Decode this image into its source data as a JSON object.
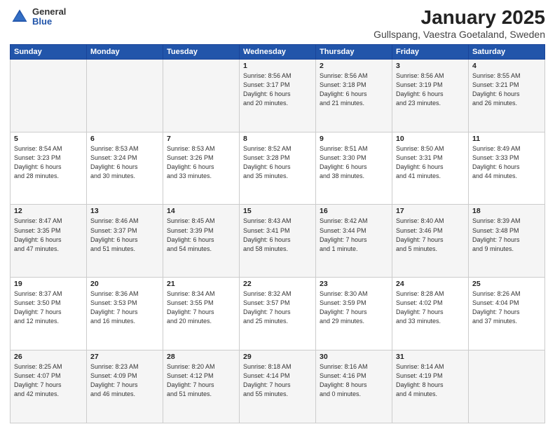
{
  "header": {
    "logo_general": "General",
    "logo_blue": "Blue",
    "title": "January 2025",
    "subtitle": "Gullspang, Vaestra Goetaland, Sweden"
  },
  "days_of_week": [
    "Sunday",
    "Monday",
    "Tuesday",
    "Wednesday",
    "Thursday",
    "Friday",
    "Saturday"
  ],
  "weeks": [
    [
      {
        "day": "",
        "info": ""
      },
      {
        "day": "",
        "info": ""
      },
      {
        "day": "",
        "info": ""
      },
      {
        "day": "1",
        "info": "Sunrise: 8:56 AM\nSunset: 3:17 PM\nDaylight: 6 hours\nand 20 minutes."
      },
      {
        "day": "2",
        "info": "Sunrise: 8:56 AM\nSunset: 3:18 PM\nDaylight: 6 hours\nand 21 minutes."
      },
      {
        "day": "3",
        "info": "Sunrise: 8:56 AM\nSunset: 3:19 PM\nDaylight: 6 hours\nand 23 minutes."
      },
      {
        "day": "4",
        "info": "Sunrise: 8:55 AM\nSunset: 3:21 PM\nDaylight: 6 hours\nand 26 minutes."
      }
    ],
    [
      {
        "day": "5",
        "info": "Sunrise: 8:54 AM\nSunset: 3:23 PM\nDaylight: 6 hours\nand 28 minutes."
      },
      {
        "day": "6",
        "info": "Sunrise: 8:53 AM\nSunset: 3:24 PM\nDaylight: 6 hours\nand 30 minutes."
      },
      {
        "day": "7",
        "info": "Sunrise: 8:53 AM\nSunset: 3:26 PM\nDaylight: 6 hours\nand 33 minutes."
      },
      {
        "day": "8",
        "info": "Sunrise: 8:52 AM\nSunset: 3:28 PM\nDaylight: 6 hours\nand 35 minutes."
      },
      {
        "day": "9",
        "info": "Sunrise: 8:51 AM\nSunset: 3:30 PM\nDaylight: 6 hours\nand 38 minutes."
      },
      {
        "day": "10",
        "info": "Sunrise: 8:50 AM\nSunset: 3:31 PM\nDaylight: 6 hours\nand 41 minutes."
      },
      {
        "day": "11",
        "info": "Sunrise: 8:49 AM\nSunset: 3:33 PM\nDaylight: 6 hours\nand 44 minutes."
      }
    ],
    [
      {
        "day": "12",
        "info": "Sunrise: 8:47 AM\nSunset: 3:35 PM\nDaylight: 6 hours\nand 47 minutes."
      },
      {
        "day": "13",
        "info": "Sunrise: 8:46 AM\nSunset: 3:37 PM\nDaylight: 6 hours\nand 51 minutes."
      },
      {
        "day": "14",
        "info": "Sunrise: 8:45 AM\nSunset: 3:39 PM\nDaylight: 6 hours\nand 54 minutes."
      },
      {
        "day": "15",
        "info": "Sunrise: 8:43 AM\nSunset: 3:41 PM\nDaylight: 6 hours\nand 58 minutes."
      },
      {
        "day": "16",
        "info": "Sunrise: 8:42 AM\nSunset: 3:44 PM\nDaylight: 7 hours\nand 1 minute."
      },
      {
        "day": "17",
        "info": "Sunrise: 8:40 AM\nSunset: 3:46 PM\nDaylight: 7 hours\nand 5 minutes."
      },
      {
        "day": "18",
        "info": "Sunrise: 8:39 AM\nSunset: 3:48 PM\nDaylight: 7 hours\nand 9 minutes."
      }
    ],
    [
      {
        "day": "19",
        "info": "Sunrise: 8:37 AM\nSunset: 3:50 PM\nDaylight: 7 hours\nand 12 minutes."
      },
      {
        "day": "20",
        "info": "Sunrise: 8:36 AM\nSunset: 3:53 PM\nDaylight: 7 hours\nand 16 minutes."
      },
      {
        "day": "21",
        "info": "Sunrise: 8:34 AM\nSunset: 3:55 PM\nDaylight: 7 hours\nand 20 minutes."
      },
      {
        "day": "22",
        "info": "Sunrise: 8:32 AM\nSunset: 3:57 PM\nDaylight: 7 hours\nand 25 minutes."
      },
      {
        "day": "23",
        "info": "Sunrise: 8:30 AM\nSunset: 3:59 PM\nDaylight: 7 hours\nand 29 minutes."
      },
      {
        "day": "24",
        "info": "Sunrise: 8:28 AM\nSunset: 4:02 PM\nDaylight: 7 hours\nand 33 minutes."
      },
      {
        "day": "25",
        "info": "Sunrise: 8:26 AM\nSunset: 4:04 PM\nDaylight: 7 hours\nand 37 minutes."
      }
    ],
    [
      {
        "day": "26",
        "info": "Sunrise: 8:25 AM\nSunset: 4:07 PM\nDaylight: 7 hours\nand 42 minutes."
      },
      {
        "day": "27",
        "info": "Sunrise: 8:23 AM\nSunset: 4:09 PM\nDaylight: 7 hours\nand 46 minutes."
      },
      {
        "day": "28",
        "info": "Sunrise: 8:20 AM\nSunset: 4:12 PM\nDaylight: 7 hours\nand 51 minutes."
      },
      {
        "day": "29",
        "info": "Sunrise: 8:18 AM\nSunset: 4:14 PM\nDaylight: 7 hours\nand 55 minutes."
      },
      {
        "day": "30",
        "info": "Sunrise: 8:16 AM\nSunset: 4:16 PM\nDaylight: 8 hours\nand 0 minutes."
      },
      {
        "day": "31",
        "info": "Sunrise: 8:14 AM\nSunset: 4:19 PM\nDaylight: 8 hours\nand 4 minutes."
      },
      {
        "day": "",
        "info": ""
      }
    ]
  ]
}
